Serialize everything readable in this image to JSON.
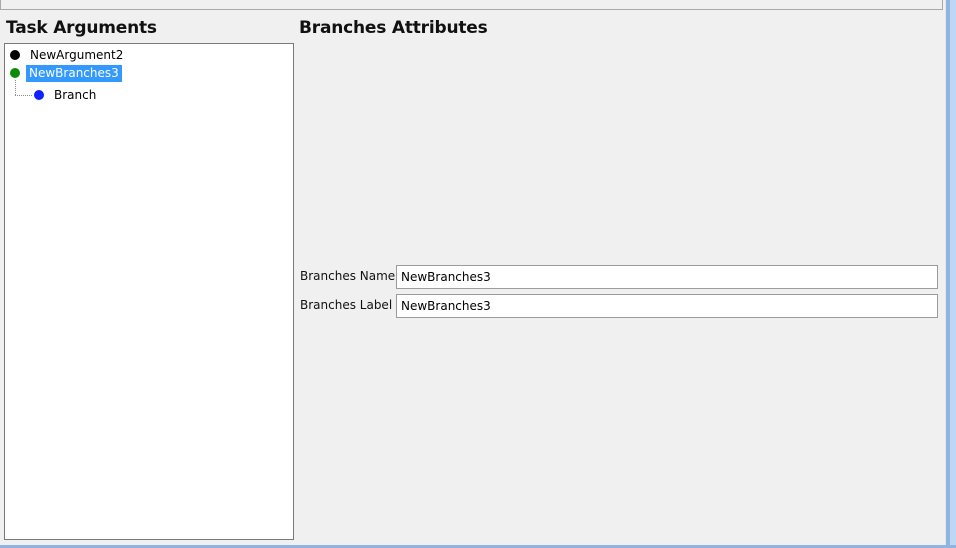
{
  "window": {
    "left_title": "Task Arguments",
    "right_title": "Branches Attributes"
  },
  "tree": {
    "items": [
      {
        "label": "NewArgument2",
        "icon": "black-circle-icon",
        "color": "#000000",
        "selected": false
      },
      {
        "label": "NewBranches3",
        "icon": "green-circle-icon",
        "color": "#0b8a0b",
        "selected": true
      },
      {
        "label": "Branch",
        "icon": "blue-circle-icon",
        "color": "#1020ff",
        "selected": false
      }
    ]
  },
  "fields": {
    "branches_name": {
      "label": "Branches Name",
      "value": "NewBranches3",
      "placeholder": ""
    },
    "branches_label": {
      "label": "Branches Label",
      "value": "NewBranches3",
      "placeholder": ""
    }
  },
  "colors": {
    "window_background": "#f0f0f0",
    "selection_background": "#3399ff",
    "frame_accent": "#8fb4e1"
  }
}
